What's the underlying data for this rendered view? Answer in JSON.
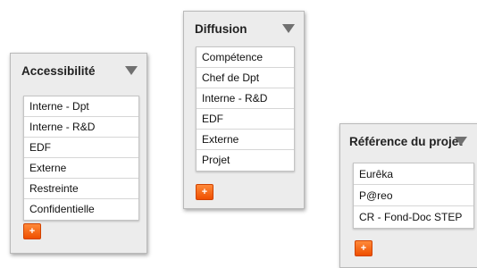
{
  "panels": {
    "accessibilite": {
      "title": "Accessibilité",
      "items": [
        "Interne - Dpt",
        "Interne - R&D",
        "EDF",
        "Externe",
        "Restreinte",
        "Confidentielle"
      ],
      "add_label": "+"
    },
    "diffusion": {
      "title": "Diffusion",
      "items": [
        "Compétence",
        "Chef de Dpt",
        "Interne - R&D",
        "EDF",
        "Externe",
        "Projet"
      ],
      "add_label": "+"
    },
    "reference": {
      "title": "Référence du projet",
      "items": [
        "Eurêka",
        "P@reo",
        "CR - Fond-Doc STEP"
      ],
      "add_label": "+"
    }
  },
  "colors": {
    "panel_bg": "#ececec",
    "add_button": "#f05a0a",
    "caret": "#707070"
  },
  "icons": {
    "dropdown": "chevron-down-icon",
    "add": "plus-icon"
  }
}
